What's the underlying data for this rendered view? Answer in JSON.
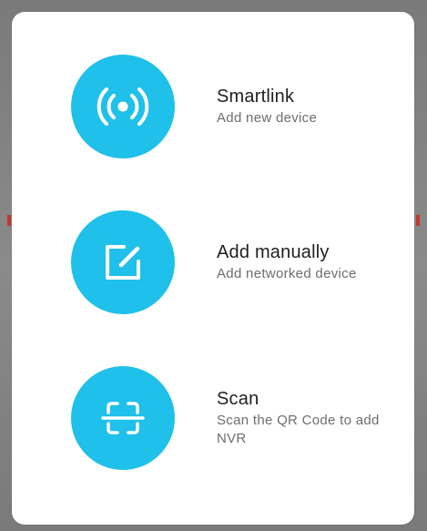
{
  "dialog": {
    "accent": "#1fc0ea",
    "options": [
      {
        "icon": "wireless-signal-icon",
        "title": "Smartlink",
        "subtitle": "Add new device"
      },
      {
        "icon": "edit-square-icon",
        "title": "Add manually",
        "subtitle": "Add networked device"
      },
      {
        "icon": "scan-frame-icon",
        "title": "Scan",
        "subtitle": "Scan the QR Code to add NVR"
      }
    ]
  }
}
